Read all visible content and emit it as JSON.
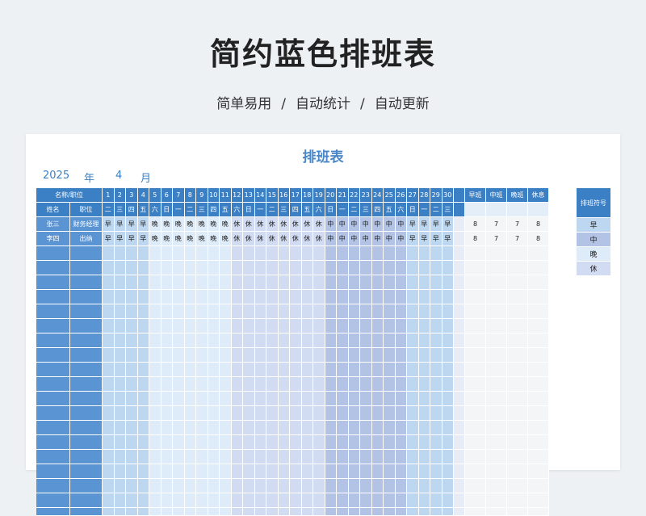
{
  "hero": {
    "title": "简约蓝色排班表",
    "subtitle_parts": [
      "简单易用",
      "自动统计",
      "自动更新"
    ],
    "separator": "/"
  },
  "sheet": {
    "title": "排班表",
    "year": "2025",
    "year_label": "年",
    "month": "4",
    "month_label": "月"
  },
  "header": {
    "name_label": "名称/职位",
    "name_col": "姓名",
    "position_col": "职位"
  },
  "days": [
    "1",
    "2",
    "3",
    "4",
    "5",
    "6",
    "7",
    "8",
    "9",
    "10",
    "11",
    "12",
    "13",
    "14",
    "15",
    "16",
    "17",
    "18",
    "19",
    "20",
    "21",
    "22",
    "23",
    "24",
    "25",
    "26",
    "27",
    "28",
    "29",
    "30"
  ],
  "weekdays": [
    "二",
    "三",
    "四",
    "五",
    "六",
    "日",
    "一",
    "二",
    "三",
    "四",
    "五",
    "六",
    "日",
    "一",
    "二",
    "三",
    "四",
    "五",
    "六",
    "日",
    "一",
    "二",
    "三",
    "四",
    "五",
    "六",
    "日",
    "一",
    "二",
    "三"
  ],
  "summary_headers": [
    "早班",
    "中班",
    "晚班",
    "休息"
  ],
  "employees": [
    {
      "name": "张三",
      "position": "财务经理",
      "shifts": [
        "早",
        "早",
        "早",
        "早",
        "晚",
        "晚",
        "晚",
        "晚",
        "晚",
        "晚",
        "晚",
        "休",
        "休",
        "休",
        "休",
        "休",
        "休",
        "休",
        "休",
        "中",
        "中",
        "中",
        "中",
        "中",
        "中",
        "中",
        "早",
        "早",
        "早",
        "早"
      ],
      "summary": [
        "8",
        "7",
        "7",
        "8"
      ]
    },
    {
      "name": "李四",
      "position": "出纳",
      "shifts": [
        "早",
        "早",
        "早",
        "早",
        "晚",
        "晚",
        "晚",
        "晚",
        "晚",
        "晚",
        "晚",
        "休",
        "休",
        "休",
        "休",
        "休",
        "休",
        "休",
        "休",
        "中",
        "中",
        "中",
        "中",
        "中",
        "中",
        "中",
        "早",
        "早",
        "早",
        "早"
      ],
      "summary": [
        "8",
        "7",
        "7",
        "8"
      ]
    }
  ],
  "legend": {
    "title": "排班符号",
    "items": [
      "早",
      "中",
      "晚",
      "休"
    ]
  },
  "colors": {
    "header_blue": "#3b7fc4",
    "name_col_blue": "#5a94d2",
    "early": "#bcd7ef",
    "evening": "#deebf8",
    "rest": "#d1dbf2",
    "mid": "#b2c3e6",
    "summary_head": "#e4eef9",
    "summary_body": "#f4f5f7"
  }
}
